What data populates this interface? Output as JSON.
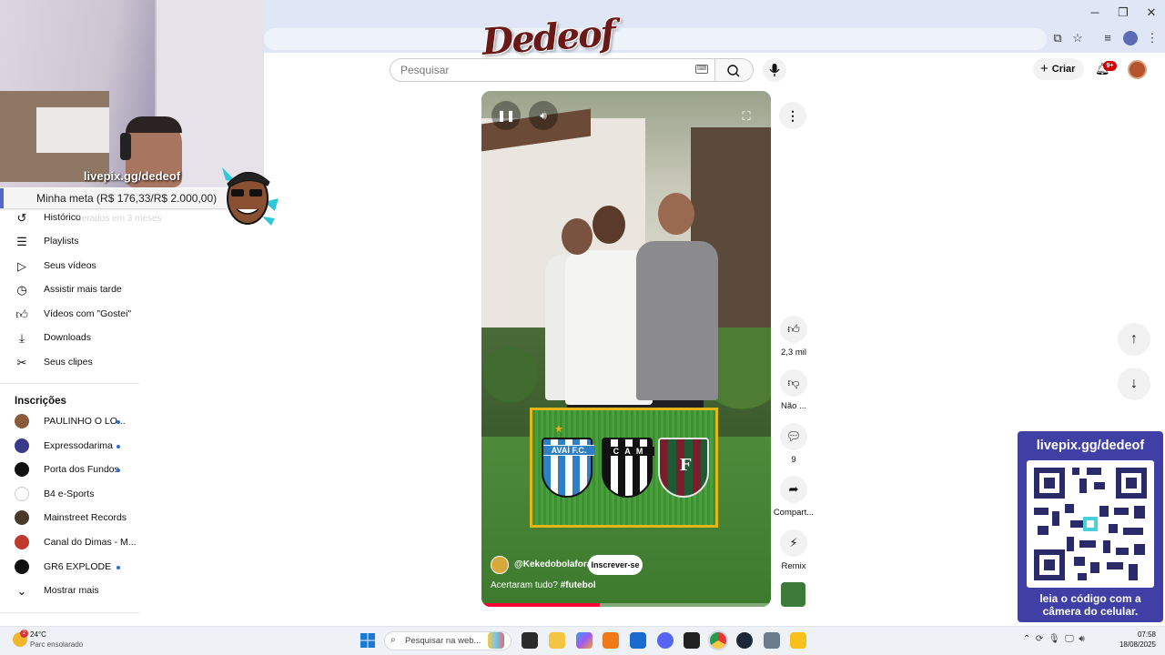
{
  "browser": {
    "window_controls": {
      "minimize": "─",
      "restore": "❐",
      "close": "✕"
    }
  },
  "overlay": {
    "logo_text": "Dedeof",
    "cam_url": "livepix.gg/dedeof",
    "goal_text": "Minha meta (R$ 176,33/R$ 2.000,00)",
    "qr_title": "livepix.gg/dedeof",
    "qr_caption_line1": "leia o código com a",
    "qr_caption_line2": "câmera do celular."
  },
  "header": {
    "search_placeholder": "Pesquisar",
    "create_label": "Criar",
    "notification_count": "9+"
  },
  "sidebar": {
    "history_sub": "Gerados em 3 meses",
    "items": [
      {
        "label": "Histórico",
        "icon": "history-icon"
      },
      {
        "label": "Playlists",
        "icon": "playlists-icon"
      },
      {
        "label": "Seus vídeos",
        "icon": "your-videos-icon"
      },
      {
        "label": "Assistir mais tarde",
        "icon": "watch-later-icon"
      },
      {
        "label": "Vídeos com \"Gostei\"",
        "icon": "liked-icon"
      },
      {
        "label": "Downloads",
        "icon": "download-icon"
      },
      {
        "label": "Seus clipes",
        "icon": "clips-icon"
      }
    ],
    "subscriptions_title": "Inscrições",
    "subscriptions": [
      {
        "name": "PAULINHO O LO...",
        "color": "#8a5a3a",
        "initial": "P",
        "dot": true
      },
      {
        "name": "Expressodarima",
        "color": "#3a3a8a",
        "initial": "E",
        "dot": true
      },
      {
        "name": "Porta dos Fundos",
        "color": "#111111",
        "initial": "1",
        "dot": true
      },
      {
        "name": "B4 e-Sports",
        "color": "#ffffff",
        "initial": "B",
        "dot": false
      },
      {
        "name": "Mainstreet Records",
        "color": "#4a3a2a",
        "initial": "M",
        "dot": false
      },
      {
        "name": "Canal do Dimas - M...",
        "color": "#c0392b",
        "initial": "C",
        "dot": false
      },
      {
        "name": "GR6 EXPLODE",
        "color": "#111111",
        "initial": "G",
        "dot": true
      }
    ],
    "show_more": "Mostrar mais"
  },
  "short": {
    "channel": "@Kekedobolafora",
    "subscribe_label": "Inscrever-se",
    "caption_text": "Acertaram tudo? ",
    "caption_tag": "#futebol",
    "progress": 0.41,
    "crests": [
      "AVAÍ F.C.",
      "C A M",
      "F"
    ],
    "likes": "2,3 mil",
    "dislike_label": "Não ...",
    "comments": "9",
    "share_label": "Compart...",
    "remix_label": "Remix"
  },
  "taskbar": {
    "temperature": "24°C",
    "weather": "Parc ensolarado",
    "weather_badge": "2",
    "search_placeholder": "Pesquisar na web...",
    "time": "07:58",
    "date": "18/08/2025"
  },
  "colors": {
    "brand_red": "#ff0033",
    "qr_bg": "#3f3fa5",
    "accent_blue": "#2a6bdc"
  }
}
